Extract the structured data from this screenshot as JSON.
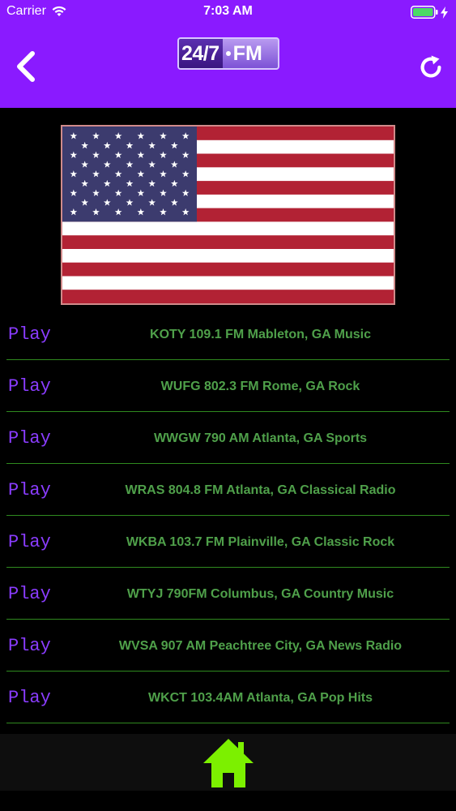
{
  "status_bar": {
    "carrier": "Carrier",
    "time": "7:03 AM"
  },
  "nav": {
    "back_icon": "chevron-left-icon",
    "refresh_icon": "refresh-icon",
    "logo_part1": "24/7",
    "logo_part2": "FM"
  },
  "colors": {
    "header_bg": "#8a1aff",
    "play_text": "#8a3cff",
    "station_text": "#4fa04a",
    "divider": "#2f8a1f",
    "home_icon": "#7cf000"
  },
  "flag": {
    "icon": "us-flag-image"
  },
  "stations": [
    {
      "play": "Play",
      "title": "KOTY 109.1 FM Mableton, GA Music"
    },
    {
      "play": "Play",
      "title": "WUFG 802.3 FM Rome, GA Rock"
    },
    {
      "play": "Play",
      "title": "WWGW 790 AM Atlanta, GA Sports"
    },
    {
      "play": "Play",
      "title": "WRAS 804.8 FM Atlanta, GA Classical Radio"
    },
    {
      "play": "Play",
      "title": "WKBA 103.7 FM Plainville, GA Classic Rock"
    },
    {
      "play": "Play",
      "title": "WTYJ 790FM Columbus, GA Country Music"
    },
    {
      "play": "Play",
      "title": "WVSA 907 AM Peachtree City, GA News Radio"
    },
    {
      "play": "Play",
      "title": "WKCT 103.4AM Atlanta, GA Pop Hits"
    }
  ],
  "footer": {
    "home_icon": "home-icon"
  }
}
